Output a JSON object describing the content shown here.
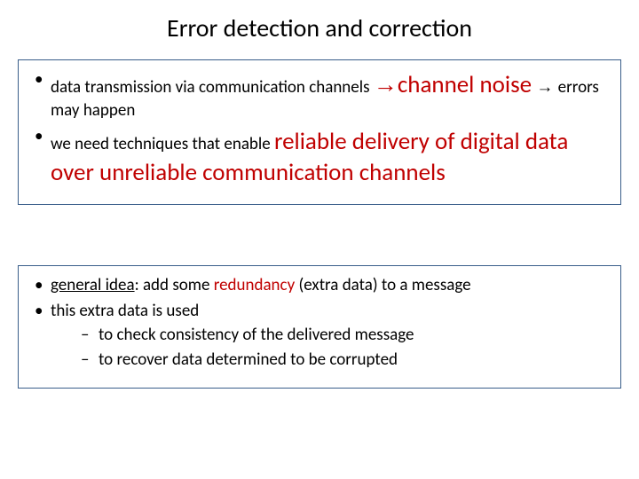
{
  "title": "Error detection and correction",
  "box1": {
    "b1_pre": "data transmission via communication channels ",
    "b1_arrow": "→",
    "b1_red1": "channel noise",
    "b1_arrow2": " → ",
    "b1_post": "errors may happen",
    "b2_pre": "we need techniques that enable ",
    "b2_red": "reliable delivery of digital data over unreliable  communication channels"
  },
  "box2": {
    "b1_ul": "general idea",
    "b1_mid": ": add some ",
    "b1_red": "redundancy",
    "b1_post": " (extra data) to a message",
    "b2": "this extra data is used",
    "sub1": "to check consistency of the delivered message",
    "sub2": "to recover data determined to be corrupted"
  }
}
